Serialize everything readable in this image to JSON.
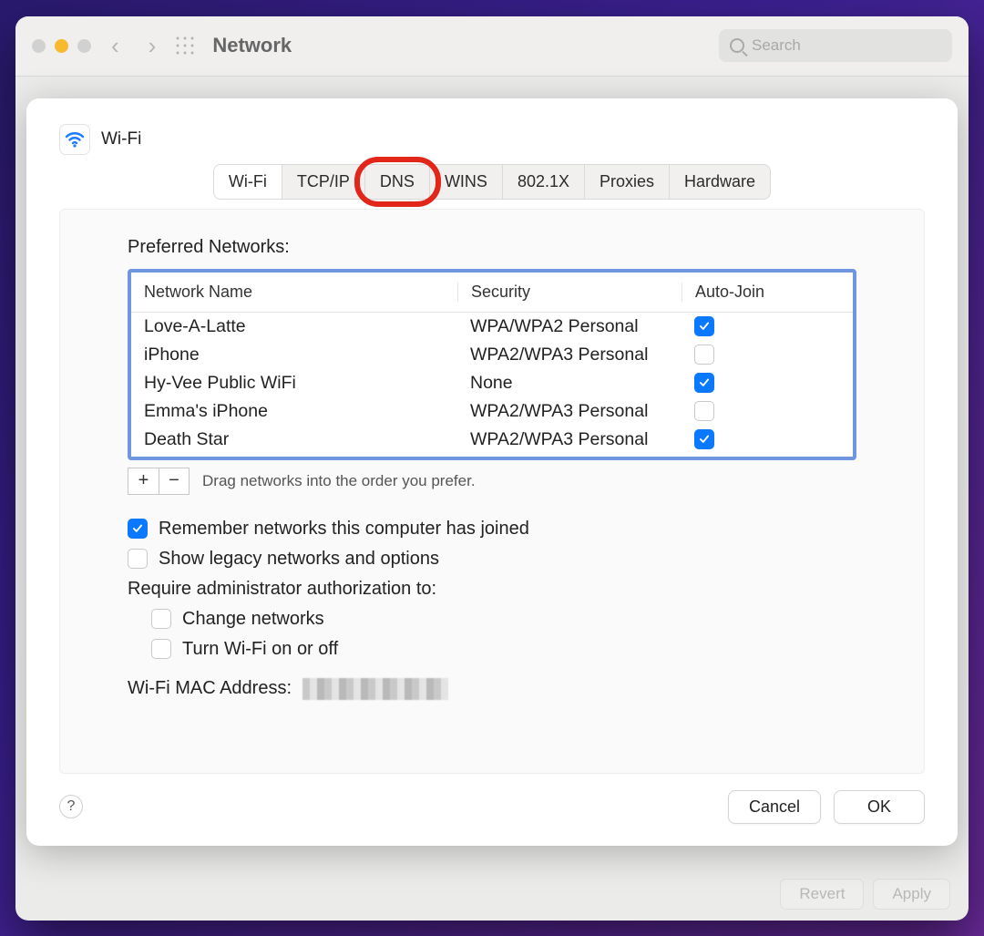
{
  "window": {
    "title": "Network",
    "search_placeholder": "Search",
    "revert_label": "Revert",
    "apply_label": "Apply"
  },
  "sheet": {
    "title": "Wi-Fi",
    "tabs": [
      {
        "id": "wifi",
        "label": "Wi-Fi"
      },
      {
        "id": "tcpip",
        "label": "TCP/IP"
      },
      {
        "id": "dns",
        "label": "DNS"
      },
      {
        "id": "wins",
        "label": "WINS"
      },
      {
        "id": "8021x",
        "label": "802.1X"
      },
      {
        "id": "proxies",
        "label": "Proxies"
      },
      {
        "id": "hardware",
        "label": "Hardware"
      }
    ],
    "active_tab_index": 0,
    "highlight_tab_index": 2,
    "preferred_label": "Preferred Networks:",
    "columns": {
      "name": "Network Name",
      "security": "Security",
      "auto": "Auto-Join"
    },
    "networks": [
      {
        "name": "Love-A-Latte",
        "security": "WPA/WPA2 Personal",
        "auto_join": true
      },
      {
        "name": "iPhone",
        "security": "WPA2/WPA3 Personal",
        "auto_join": false
      },
      {
        "name": "Hy-Vee Public WiFi",
        "security": "None",
        "auto_join": true
      },
      {
        "name": "Emma's iPhone",
        "security": "WPA2/WPA3 Personal",
        "auto_join": false
      },
      {
        "name": "Death Star",
        "security": "WPA2/WPA3 Personal",
        "auto_join": true
      }
    ],
    "add_label": "+",
    "remove_label": "−",
    "drag_hint": "Drag networks into the order you prefer.",
    "remember": {
      "checked": true,
      "label": "Remember networks this computer has joined"
    },
    "legacy": {
      "checked": false,
      "label": "Show legacy networks and options"
    },
    "auth_header": "Require administrator authorization to:",
    "auth_change": {
      "checked": false,
      "label": "Change networks"
    },
    "auth_toggle": {
      "checked": false,
      "label": "Turn Wi-Fi on or off"
    },
    "mac_label": "Wi-Fi MAC Address:",
    "cancel_label": "Cancel",
    "ok_label": "OK",
    "help_label": "?"
  }
}
